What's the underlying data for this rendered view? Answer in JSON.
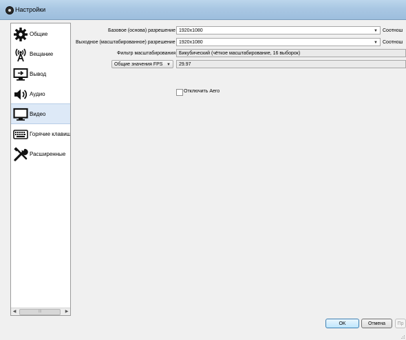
{
  "window": {
    "title": "Настройки"
  },
  "sidebar": {
    "items": [
      {
        "label": "Общие",
        "icon": "gear-icon"
      },
      {
        "label": "Вещание",
        "icon": "broadcast-antenna-icon"
      },
      {
        "label": "Вывод",
        "icon": "output-monitor-icon"
      },
      {
        "label": "Аудио",
        "icon": "speaker-icon"
      },
      {
        "label": "Видео",
        "icon": "monitor-icon",
        "selected": true
      },
      {
        "label": "Горячие клавиши",
        "icon": "keyboard-icon"
      },
      {
        "label": "Расширенные",
        "icon": "tools-icon"
      }
    ],
    "scrollbar_grip": "⁞⁞⁞"
  },
  "video": {
    "base_resolution_label": "Базовое (основа) разрешение",
    "base_resolution_value": "1920x1080",
    "output_resolution_label": "Выходное (масштабированное) разрешение",
    "output_resolution_value": "1920x1080",
    "aspect_label": "Соотнош",
    "filter_label": "Фильтр масштабирования",
    "filter_value": "Бикубический (чёткое масштабирование, 16 выборок)",
    "fps_type_value": "Общие значения FPS",
    "fps_value": "29.97",
    "disable_aero_label": "Отключить Aero"
  },
  "footer": {
    "ok_label": "OK",
    "cancel_label": "Отмена",
    "apply_label": "Пр"
  },
  "colors": {
    "selected_bg": "#dde9f7",
    "titlebar": "#a9c7e3",
    "ok_border": "#3c7fb1"
  }
}
